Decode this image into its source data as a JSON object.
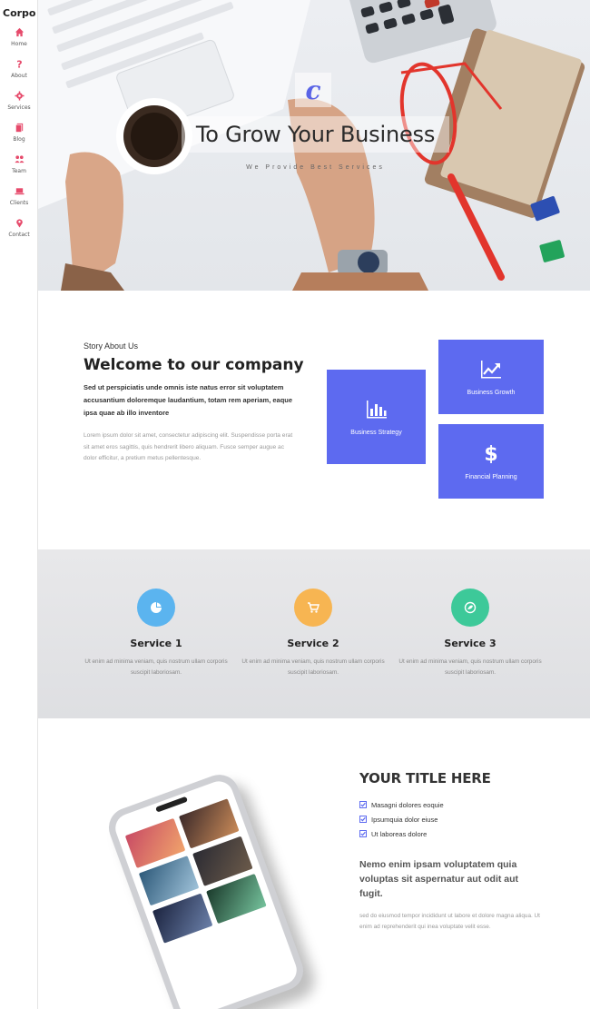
{
  "brand": "Corpo",
  "nav": [
    {
      "label": "Home",
      "icon": "home-icon"
    },
    {
      "label": "About",
      "icon": "question-icon"
    },
    {
      "label": "Services",
      "icon": "gear-icon"
    },
    {
      "label": "Blog",
      "icon": "document-icon"
    },
    {
      "label": "Team",
      "icon": "users-icon"
    },
    {
      "label": "Clients",
      "icon": "laptop-icon"
    },
    {
      "label": "Contact",
      "icon": "map-pin-icon"
    }
  ],
  "colors": {
    "accent": "#5d6af0",
    "nav_icon": "#e64a6b",
    "svc1": "#5bb4ef",
    "svc2": "#f7b552",
    "svc3": "#3dc999"
  },
  "hero": {
    "badge": "c",
    "title": "To Grow Your Business",
    "subtitle": "We Provide Best Services"
  },
  "about": {
    "kicker": "Story About Us",
    "title": "Welcome to our company",
    "lead": "Sed ut perspiciatis unde omnis iste natus error sit voluptatem accusantium doloremque laudantium, totam rem aperiam, eaque ipsa quae ab illo inventore",
    "body": "Lorem ipsum dolor sit amet, consectetur adipiscing elit. Suspendisse porta erat sit amet eros sagittis, quis hendrerit libero aliquam. Fusce semper augue ac dolor efficitur, a pretium metus pellentesque.",
    "tiles": [
      {
        "label": "Business Strategy",
        "icon": "bar-chart-icon"
      },
      {
        "label": "Business Growth",
        "icon": "line-chart-icon"
      },
      {
        "label": "Financial Planning",
        "icon": "dollar-icon"
      }
    ]
  },
  "services": [
    {
      "title": "Service 1",
      "text": "Ut enim ad minima veniam, quis nostrum ullam corporis suscipit laboriosam.",
      "icon": "pie-chart-icon"
    },
    {
      "title": "Service 2",
      "text": "Ut enim ad minima veniam, quis nostrum ullam corporis suscipit laboriosam.",
      "icon": "cart-icon"
    },
    {
      "title": "Service 3",
      "text": "Ut enim ad minima veniam, quis nostrum ullam corporis suscipit laboriosam.",
      "icon": "leaf-icon"
    }
  ],
  "feature": {
    "title": "YOUR TITLE HERE",
    "checks": [
      "Masagni dolores eoquie",
      "Ipsumquia dolor eiuse",
      "Ut laboreas dolore"
    ],
    "lead": "Nemo enim ipsam voluptatem quia voluptas sit aspernatur aut odit aut fugit.",
    "body": "sed do eiusmod tempor incididunt ut labore et dolore magna aliqua. Ut enim ad reprehenderit qui inea voluptate velit esse."
  }
}
